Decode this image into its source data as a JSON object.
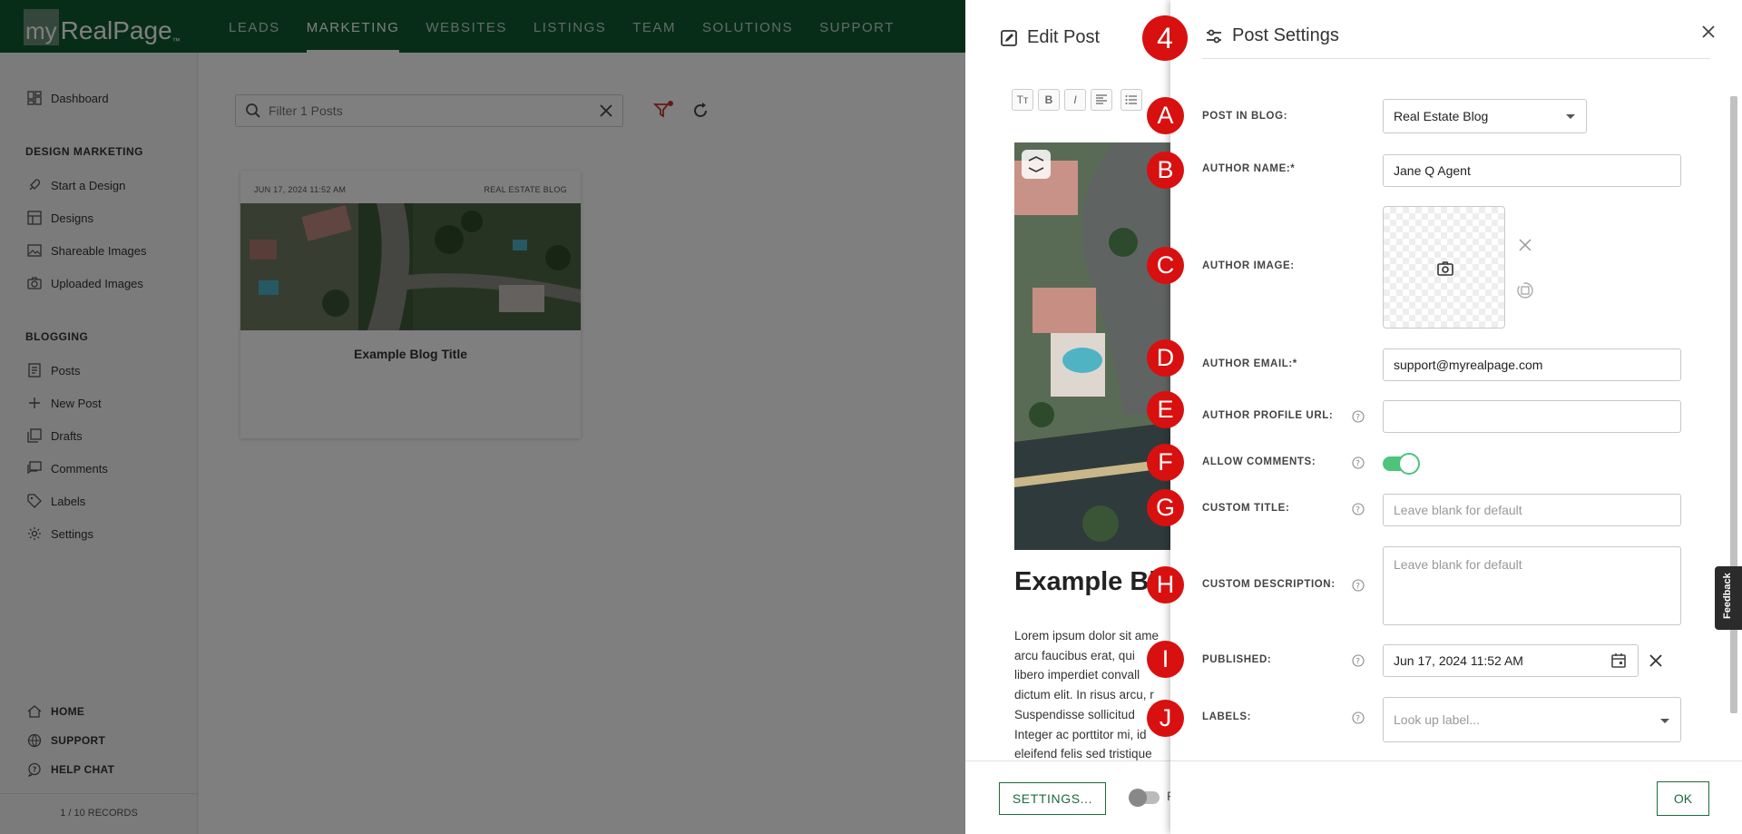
{
  "logo": {
    "my": "my",
    "rest": "RealPage",
    "tm": "™"
  },
  "nav": [
    "LEADS",
    "MARKETING",
    "WEBSITES",
    "LISTINGS",
    "TEAM",
    "SOLUTIONS",
    "SUPPORT"
  ],
  "sidebar": {
    "dashboard": "Dashboard",
    "design_marketing_heading": "DESIGN MARKETING",
    "design_items": [
      "Start a Design",
      "Designs",
      "Shareable Images",
      "Uploaded Images"
    ],
    "blogging_heading": "BLOGGING",
    "blog_items": [
      "Posts",
      "New Post",
      "Drafts",
      "Comments",
      "Labels",
      "Settings"
    ],
    "bottom_items": [
      "HOME",
      "SUPPORT",
      "HELP CHAT"
    ],
    "records": "1 / 10 RECORDS"
  },
  "main": {
    "filter_placeholder": "Filter 1 Posts",
    "card": {
      "date": "JUN 17, 2024 11:52 AM",
      "blog": "REAL ESTATE BLOG",
      "title": "Example Blog Title"
    }
  },
  "edit_post": {
    "title": "Edit Post",
    "toolbar": [
      "Tт",
      "B",
      "I"
    ],
    "post_title": "Example Bl",
    "body_lines": [
      "Lorem ipsum dolor sit ame",
      "arcu faucibus erat, qui",
      "libero imperdiet convall",
      "dictum elit. In risus arcu, r",
      "Suspendisse sollicitud",
      "Integer ac porttitor mi, id",
      "eleifend felis sed tristique"
    ],
    "settings_button": "SETTINGS...",
    "footer_letter": "F"
  },
  "post_settings": {
    "title": "Post Settings",
    "post_in_blog_label": "POST IN BLOG:",
    "post_in_blog_value": "Real Estate Blog",
    "author_name_label": "AUTHOR NAME:*",
    "author_name_value": "Jane Q Agent",
    "author_image_label": "AUTHOR IMAGE:",
    "author_email_label": "AUTHOR EMAIL:*",
    "author_email_value": "support@myrealpage.com",
    "author_profile_url_label": "AUTHOR PROFILE URL:",
    "author_profile_url_value": "",
    "allow_comments_label": "ALLOW COMMENTS:",
    "allow_comments_on": true,
    "custom_title_label": "CUSTOM TITLE:",
    "custom_title_placeholder": "Leave blank for default",
    "custom_description_label": "CUSTOM DESCRIPTION:",
    "custom_description_placeholder": "Leave blank for default",
    "published_label": "PUBLISHED:",
    "published_value": "Jun 17, 2024 11:52 AM",
    "labels_label": "LABELS:",
    "labels_placeholder": "Look up label...",
    "ok_button": "OK"
  },
  "badges": {
    "panel": "4",
    "A": "A",
    "B": "B",
    "C": "C",
    "D": "D",
    "E": "E",
    "F": "F",
    "G": "G",
    "H": "H",
    "I": "I",
    "J": "J"
  },
  "feedback": "Feedback",
  "colors": {
    "nav_bg": "#0f5a32",
    "accent_green": "#1b6b3f",
    "toggle_on": "#4cc47a",
    "badge_red": "#d81010"
  }
}
